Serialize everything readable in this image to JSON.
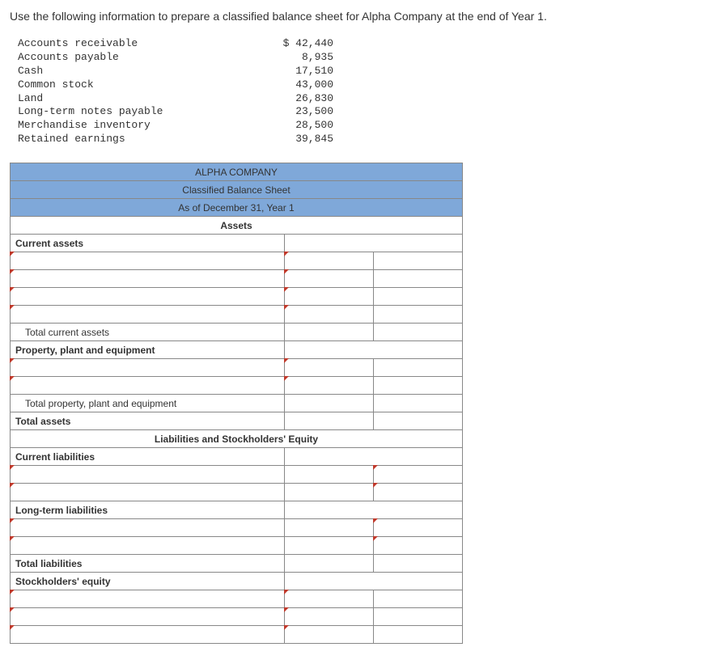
{
  "instruction": "Use the following information to prepare a classified balance sheet for Alpha Company at the end of Year 1.",
  "accounts": [
    {
      "label": "Accounts receivable",
      "value": "$ 42,440"
    },
    {
      "label": "Accounts payable",
      "value": "8,935"
    },
    {
      "label": "Cash",
      "value": "17,510"
    },
    {
      "label": "Common stock",
      "value": "43,000"
    },
    {
      "label": "Land",
      "value": "26,830"
    },
    {
      "label": "Long-term notes payable",
      "value": "23,500"
    },
    {
      "label": "Merchandise inventory",
      "value": "28,500"
    },
    {
      "label": "Retained earnings",
      "value": "39,845"
    }
  ],
  "sheet": {
    "title1": "ALPHA COMPANY",
    "title2": "Classified Balance Sheet",
    "title3": "As of December 31, Year 1",
    "assets_hdr": "Assets",
    "current_assets": "Current assets",
    "total_current_assets": "Total current assets",
    "ppe": "Property, plant and equipment",
    "total_ppe": "Total property, plant and equipment",
    "total_assets": "Total assets",
    "liab_hdr": "Liabilities and Stockholders' Equity",
    "current_liab": "Current liabilities",
    "lt_liab": "Long-term liabilities",
    "total_liab": "Total liabilities",
    "se": "Stockholders' equity"
  }
}
